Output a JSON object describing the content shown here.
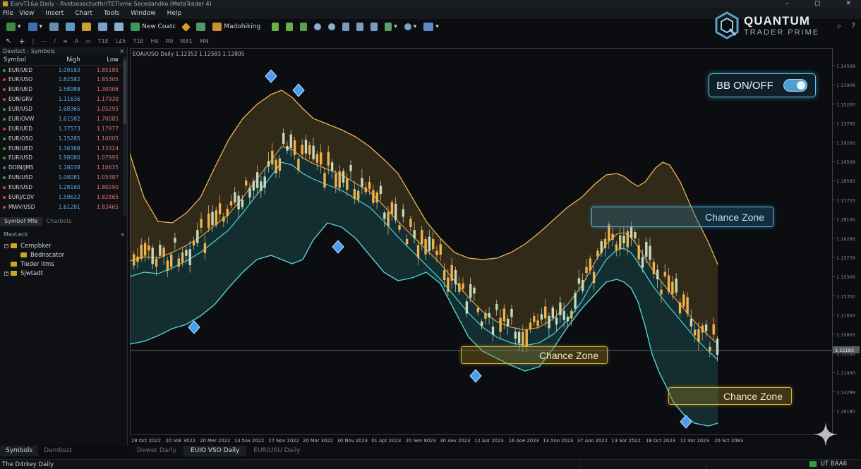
{
  "window": {
    "title": "EurvT1&a Daily - Rvetsosectucthr/TETivme Secedandko (MetaTrader 4)",
    "controls": [
      "–",
      "▢",
      "✕"
    ]
  },
  "menu": [
    "File",
    "View",
    "Insert",
    "Chart",
    "Tools",
    "Window",
    "Help"
  ],
  "toolbar": {
    "new_order": "New Coatc",
    "autotrading": "Madohiking"
  },
  "timeframes": [
    "T1E",
    "L£5",
    "T1E",
    "H4",
    "R9",
    "MA1",
    "MN"
  ],
  "logo": {
    "line1": "QUANTUM",
    "line2": "TRADER PRIME"
  },
  "market_watch": {
    "title": "Davilsct - Symbols",
    "headers": {
      "symbol": "Symbol",
      "high": "Nigh",
      "low": "Low"
    },
    "rows": [
      {
        "symbol": "EUR/UED",
        "high": "1.09183",
        "low": "1.85185",
        "dot": "#2ea043"
      },
      {
        "symbol": "EUR/USO",
        "high": "1.82582",
        "low": "1.85305",
        "dot": "#d04040"
      },
      {
        "symbol": "EUR/UED",
        "high": "1.58988",
        "low": "1.30006",
        "dot": "#d04040"
      },
      {
        "symbol": "EUN/GRV",
        "high": "1.11636",
        "low": "1.17930",
        "dot": "#d04040"
      },
      {
        "symbol": "EUR/USD",
        "high": "1.68365",
        "low": "1.05295",
        "dot": "#2ea043"
      },
      {
        "symbol": "EUR/OVW",
        "high": "1.61582",
        "low": "1.70085",
        "dot": "#2ea043"
      },
      {
        "symbol": "EUR/UED",
        "high": "1.37573",
        "low": "1.17977",
        "dot": "#d04040"
      },
      {
        "symbol": "EUR/OSO",
        "high": "1.15285",
        "low": "1.10005",
        "dot": "#2ea043"
      },
      {
        "symbol": "EUN/UED",
        "high": "1.36368",
        "low": "1.13324",
        "dot": "#2ea043"
      },
      {
        "symbol": "EUR/USD",
        "high": "1.98080",
        "low": "1.07995",
        "dot": "#2ea043"
      },
      {
        "symbol": "DOIN/JMS",
        "high": "1.18038",
        "low": "1.10635",
        "dot": "#2ea043"
      },
      {
        "symbol": "EUN/USD",
        "high": "1.08081",
        "low": "1.05387",
        "dot": "#2ea043"
      },
      {
        "symbol": "EUR/USD",
        "high": "1.28160",
        "low": "1.80290",
        "dot": "#d04040"
      },
      {
        "symbol": "EURJ/CDV",
        "high": "1.58622",
        "low": "1.82865",
        "dot": "#d04040"
      },
      {
        "symbol": "MWV/USD",
        "high": "1.61281",
        "low": "1.83465",
        "dot": "#d04040"
      }
    ],
    "tabs": [
      "Symbof Mfe",
      "Charbots"
    ]
  },
  "navigator": {
    "title": "MavLeck",
    "items": [
      {
        "label": "Cempbker",
        "indent": 0,
        "pm": "−"
      },
      {
        "label": "Bednscator",
        "indent": 1,
        "pm": ""
      },
      {
        "label": "Tieder itms",
        "indent": 0,
        "pm": ""
      },
      {
        "label": "Sjwtadt",
        "indent": 0,
        "pm": "+"
      }
    ]
  },
  "bottom_tabs": [
    "Symbols",
    "Dambsst"
  ],
  "chart_tabs": [
    "Dewer Darly",
    "EUIO VSO Daily",
    "EUR/USU Daily"
  ],
  "status": {
    "left": "The D4rkey Daily",
    "right": "UT BAA6"
  },
  "chart_header": "EOA//USO Daily 1.12352 1.12583 1.12805",
  "toggle": {
    "label": "BB ON/OFF",
    "on": true
  },
  "zones": [
    "Chance Zone",
    "Chance Zone",
    "Chance Zone"
  ],
  "chart_data": {
    "type": "candlestick",
    "title": "EOA//USO Daily 1.12352 1.12583 1.12805",
    "y_ticks": [
      "1.14508",
      "1.13908",
      "1.15200",
      "1.13700",
      "1.19200",
      "1.19508",
      "1.18593",
      "1.17753",
      "1.18100",
      "1.16280",
      "1.15778",
      "1.15306",
      "1.15300",
      "1.11650",
      "1.15805",
      "1.15183",
      "1.11930",
      "1.14298",
      "1.16180"
    ],
    "current_price": "1.15183",
    "x_ticks": [
      "28 Oct 2022",
      "20 Vok 3022",
      "20 Mer 2022",
      "13.5ox 2022",
      "27 Nov 2022",
      "20 Mar 3022",
      "30 Nov 2023",
      "01 Apr 2023",
      "20 Sen 8023",
      "30 Aev 2023",
      "12 Aor 2023",
      "16 Aoe 2023",
      "13 Xoo 2023",
      "37 Aoo 2022",
      "13 Sor 2522",
      "18 Oct 2023",
      "12 Vor 2023",
      "20 Sct 2083"
    ],
    "bands_visible": true,
    "colors": {
      "bull": "#f0b24a",
      "bear": "#f0b24a",
      "upper_band": "#f0b455",
      "lower_band": "#52d6d2",
      "middle_band": "#f0b455"
    }
  }
}
